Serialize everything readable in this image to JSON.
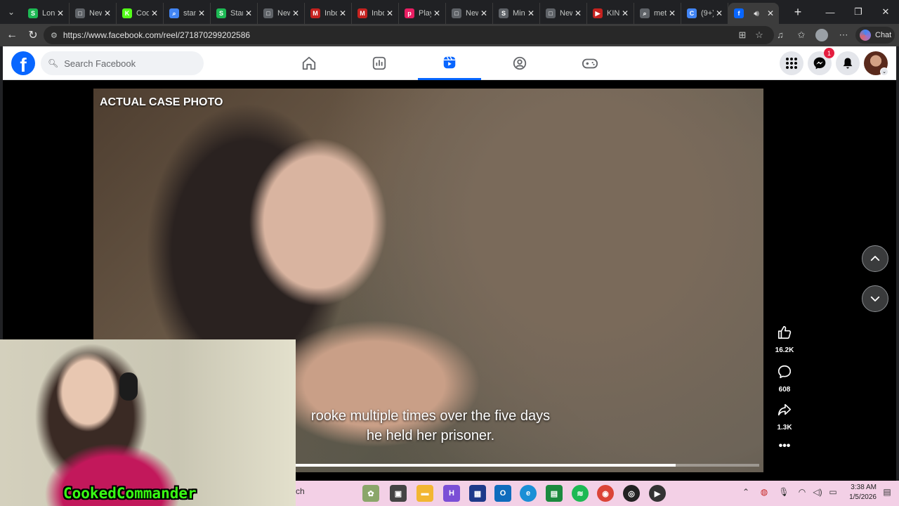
{
  "browser": {
    "tabs": [
      {
        "label": "Lon",
        "fav": "S",
        "color": "#1db954",
        "active": false
      },
      {
        "label": "New",
        "fav": "□",
        "color": "#5f6368",
        "active": false
      },
      {
        "label": "Coo",
        "fav": "K",
        "color": "#53fc18",
        "active": false
      },
      {
        "label": "stan",
        "fav": "⌕",
        "color": "#4285f4",
        "active": false
      },
      {
        "label": "Stan",
        "fav": "S",
        "color": "#1db954",
        "active": false
      },
      {
        "label": "New",
        "fav": "□",
        "color": "#5f6368",
        "active": false
      },
      {
        "label": "Inbo",
        "fav": "M",
        "color": "#c5221f",
        "active": false
      },
      {
        "label": "Inbo",
        "fav": "M",
        "color": "#c5221f",
        "active": false
      },
      {
        "label": "Play",
        "fav": "p",
        "color": "#e91e63",
        "active": false
      },
      {
        "label": "New",
        "fav": "□",
        "color": "#5f6368",
        "active": false
      },
      {
        "label": "Min",
        "fav": "S",
        "color": "#5f6368",
        "active": false
      },
      {
        "label": "New",
        "fav": "□",
        "color": "#5f6368",
        "active": false
      },
      {
        "label": "KIN",
        "fav": "▶",
        "color": "#c5221f",
        "active": false
      },
      {
        "label": "met",
        "fav": "⌕",
        "color": "#5f6368",
        "active": false
      },
      {
        "label": "(9+)",
        "fav": "C",
        "color": "#4285f4",
        "active": false
      },
      {
        "label": "",
        "fav": "f",
        "color": "#0866ff",
        "active": true
      }
    ],
    "url": "https://www.facebook.com/reel/271870299202586",
    "chat_label": "Chat"
  },
  "facebook": {
    "search_placeholder": "Search Facebook",
    "messenger_badge": "1"
  },
  "reel": {
    "overlay_label": "ACTUAL CASE PHOTO",
    "subtitle_line1": "rooke multiple times over the five days",
    "subtitle_line2": "he held her prisoner.",
    "progress": 0.82,
    "likes": "16.2K",
    "comments": "608",
    "shares": "1.3K"
  },
  "webcam": {
    "streamer_name": "CookedCommander"
  },
  "taskbar": {
    "search_fragment": "ch",
    "time": "3:38 AM",
    "date": "1/5/2026"
  }
}
